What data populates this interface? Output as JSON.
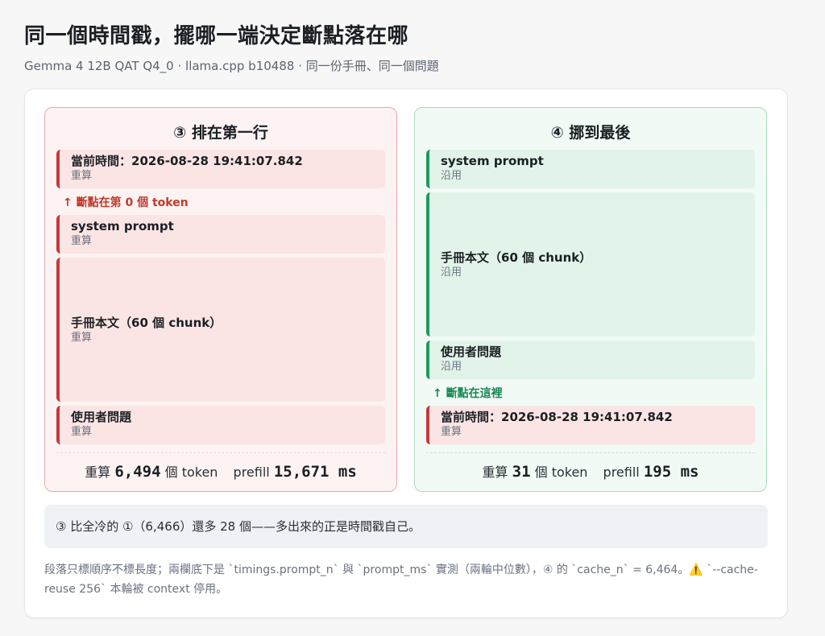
{
  "title": "同一個時間戳，擺哪一端決定斷點落在哪",
  "subtitle": "Gemma 4 12B QAT Q4_0 · llama.cpp b10488 · 同一份手冊、同一個問題",
  "left": {
    "title": "③ 排在第一行",
    "blocks": [
      {
        "label": "當前時間：2026-08-28 19:41:07.842",
        "status": "重算"
      },
      {
        "label": "system prompt",
        "status": "重算"
      },
      {
        "label": "手冊本文（60 個 chunk）",
        "status": "重算"
      },
      {
        "label": "使用者問題",
        "status": "重算"
      }
    ],
    "break_label": "↑ 斷點在第 0 個 token",
    "stats": {
      "recompute_label": "重算",
      "recompute_value": "6,494",
      "unit": "個 token",
      "prefill_label": "prefill",
      "prefill_value": "15,671 ms"
    }
  },
  "right": {
    "title": "④ 挪到最後",
    "blocks": [
      {
        "label": "system prompt",
        "status": "沿用"
      },
      {
        "label": "手冊本文（60 個 chunk）",
        "status": "沿用"
      },
      {
        "label": "使用者問題",
        "status": "沿用"
      },
      {
        "label": "當前時間：2026-08-28 19:41:07.842",
        "status": "重算"
      }
    ],
    "break_label": "↑ 斷點在這裡",
    "stats": {
      "recompute_label": "重算",
      "recompute_value": "31",
      "unit": "個 token",
      "prefill_label": "prefill",
      "prefill_value": "195 ms"
    }
  },
  "note": "③ 比全冷的 ①（6,466）還多 28 個——多出來的正是時間戳自己。",
  "footnote": "段落只標順序不標長度；兩欄底下是 `timings.prompt_n` 與 `prompt_ms` 實測（兩輪中位數），④ 的 `cache_n` = 6,464。⚠️ `--cache-reuse 256` 本輪被 context 停用。",
  "colors": {
    "recompute": "#c7373a",
    "reuse": "#1d9a5b"
  }
}
